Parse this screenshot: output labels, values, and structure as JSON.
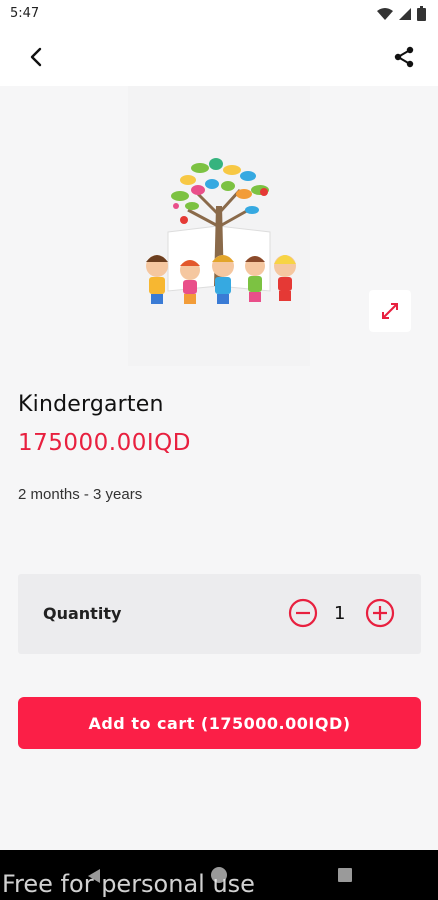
{
  "status_bar": {
    "time": "5:47",
    "icons": [
      "wifi-icon",
      "signal-icon",
      "battery-icon"
    ]
  },
  "app_bar": {
    "back_icon": "chevron-left-icon",
    "share_icon": "share-icon"
  },
  "product": {
    "image_alt": "kindergarten-illustration",
    "expand_icon": "expand-icon",
    "name": "Kindergarten",
    "price": "175000.00IQD",
    "age_range": "2 months - 3 years"
  },
  "quantity": {
    "label": "Quantity",
    "value": "1",
    "minus_icon": "minus-circle-icon",
    "plus_icon": "plus-circle-icon"
  },
  "cart": {
    "button_label": "Add to cart (175000.00IQD)"
  },
  "nav_bar": {
    "back_icon": "nav-back-icon",
    "home_icon": "nav-home-icon",
    "recent_icon": "nav-recents-icon"
  },
  "watermark": "Free for personal use",
  "colors": {
    "accent": "#fb1f47",
    "price": "#e8203f",
    "background": "#f6f6f7",
    "card": "#ececee"
  }
}
